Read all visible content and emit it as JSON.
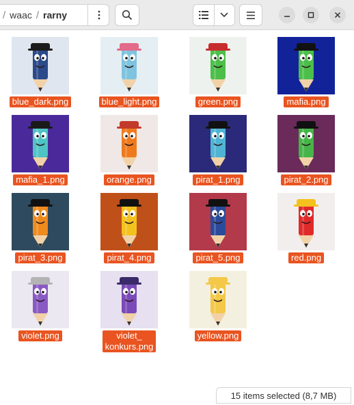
{
  "breadcrumb": {
    "separator": "/",
    "parent": "waac",
    "current": "rarny"
  },
  "icons": {
    "path_menu": "vertical-dots-icon",
    "search": "search-icon",
    "list_view": "list-view-icon",
    "view_options": "chevron-down-icon",
    "main_menu": "hamburger-icon",
    "minimize": "minimize-icon",
    "maximize": "maximize-icon",
    "close": "close-icon"
  },
  "colors": {
    "selection": "#e95420",
    "header": "#ebebeb"
  },
  "files": [
    {
      "name": "blue_dark.png",
      "bg": "#dfe6f0",
      "body": "#2a4a8a",
      "hat": "#1c1c1c"
    },
    {
      "name": "blue_light.png",
      "bg": "#e4eef3",
      "body": "#7ec3df",
      "hat": "#e36a8a"
    },
    {
      "name": "green.png",
      "bg": "#eef2ee",
      "body": "#4cbf4a",
      "hat": "#c72d2d"
    },
    {
      "name": "mafia.png",
      "bg": "#12239a",
      "body": "#4cbf4a",
      "hat": "#111111"
    },
    {
      "name": "mafia_1.png",
      "bg": "#4a2a9a",
      "body": "#4fc4c4",
      "hat": "#1a1a1a"
    },
    {
      "name": "orange.png",
      "bg": "#f0e8e6",
      "body": "#ef7a1e",
      "hat": "#c23a2a"
    },
    {
      "name": "pirat_1.png",
      "bg": "#2b2a7a",
      "body": "#4fb4d4",
      "hat": "#111111"
    },
    {
      "name": "pirat_2.png",
      "bg": "#6a2a5a",
      "body": "#46b448",
      "hat": "#111111"
    },
    {
      "name": "pirat_3.png",
      "bg": "#2e4a5e",
      "body": "#ef8a1e",
      "hat": "#111111"
    },
    {
      "name": "pirat_4.png",
      "bg": "#c0501a",
      "body": "#f4c21e",
      "hat": "#111111"
    },
    {
      "name": "pirat_5.png",
      "bg": "#b23a4a",
      "body": "#2a4a9a",
      "hat": "#111111"
    },
    {
      "name": "red.png",
      "bg": "#f2eeee",
      "body": "#e02a2a",
      "hat": "#f4c21e"
    },
    {
      "name": "violet.png",
      "bg": "#ece8f2",
      "body": "#8a5ac4",
      "hat": "#b4b4b4"
    },
    {
      "name": "violet_\nkonkurs.png",
      "bg": "#e6e0f0",
      "body": "#7a4ab8",
      "hat": "#3a2a6a"
    },
    {
      "name": "yellow.png",
      "bg": "#f4f0e0",
      "body": "#f4c848",
      "hat": "#f4c848"
    }
  ],
  "status": {
    "text": "15 items selected  (8,7 MB)"
  }
}
